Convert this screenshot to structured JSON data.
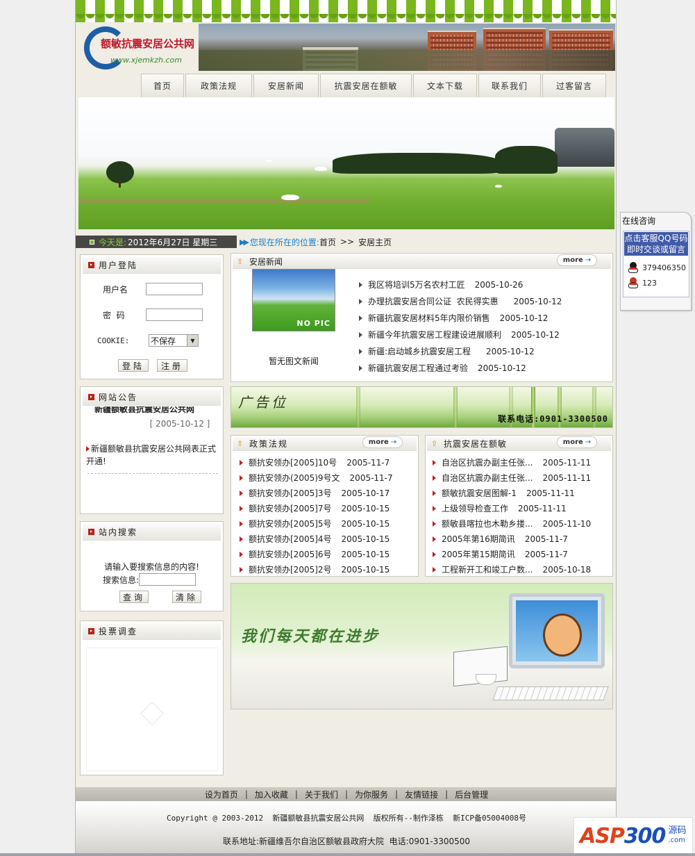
{
  "site": {
    "logo_title": "额敏抗震安居公共网",
    "logo_url": "www.xjemkzh.com"
  },
  "nav": [
    "首页",
    "政策法规",
    "安居新闻",
    "抗震安居在额敏",
    "文本下载",
    "联系我们",
    "过客留言"
  ],
  "status": {
    "date_label": "今天是:",
    "date_value": "2012年6月27日 星期三",
    "location_label": "您现在所在的位置:",
    "location_home": "首页",
    "location_sep": ">>",
    "location_current": "安居主页"
  },
  "login": {
    "title": "用户登陆",
    "username_label": "用户名",
    "password_label": "密  码",
    "cookie_label": "COOKIE:",
    "cookie_value": "不保存",
    "login_btn": "登陆",
    "register_btn": "注册"
  },
  "notice": {
    "title": "网站公告",
    "scroll_text": "新疆额敏县抗震安居公共网",
    "date": "[ 2005-10-12 ]",
    "item": "新疆额敏县抗震安居公共网表正式开通!"
  },
  "search": {
    "title": "站内搜索",
    "prompt": "请输入要搜索信息的内容!",
    "label": "搜索信息:",
    "query_btn": "查询",
    "clear_btn": "清除"
  },
  "poll": {
    "title": "投票调查"
  },
  "news": {
    "title": "安居新闻",
    "more": "more",
    "no_pic": "NO PIC",
    "no_pic_caption": "暂无图文新闻",
    "items": [
      {
        "title": "我区将培训5万名农村工匠",
        "date": "2005-10-26"
      },
      {
        "title": "办理抗震安居合同公证  农民得实惠",
        "date": "2005-10-12"
      },
      {
        "title": "新疆抗震安居材料5年内限价销售",
        "date": "2005-10-12"
      },
      {
        "title": "新疆今年抗震安居工程建设进展顺利",
        "date": "2005-10-12"
      },
      {
        "title": "新疆:启动城乡抗震安居工程",
        "date": "2005-10-12"
      },
      {
        "title": "新疆抗震安居工程通过考验",
        "date": "2005-10-12"
      }
    ]
  },
  "ad": {
    "title": "广告位",
    "phone": "联系电话:0901-3300500",
    "slogan": "我们每天都在进步"
  },
  "policy": {
    "title": "政策法规",
    "more": "more",
    "items": [
      {
        "title": "额抗安领办[2005]10号",
        "date": "2005-11-7"
      },
      {
        "title": "额抗安领办(2005)9号文",
        "date": "2005-11-7"
      },
      {
        "title": "额抗安领办[2005]3号",
        "date": "2005-10-17"
      },
      {
        "title": "额抗安领办[2005]7号",
        "date": "2005-10-15"
      },
      {
        "title": "额抗安领办[2005]5号",
        "date": "2005-10-15"
      },
      {
        "title": "额抗安领办[2005]4号",
        "date": "2005-10-15"
      },
      {
        "title": "额抗安领办[2005]6号",
        "date": "2005-10-15"
      },
      {
        "title": "额抗安领办[2005]2号",
        "date": "2005-10-15"
      }
    ]
  },
  "emin": {
    "title": "抗震安居在额敏",
    "more": "more",
    "items": [
      {
        "title": "自治区抗震办副主任张...",
        "date": "2005-11-11"
      },
      {
        "title": "自治区抗震办副主任张...",
        "date": "2005-11-11"
      },
      {
        "title": "额敏抗震安居图解-1",
        "date": "2005-11-11"
      },
      {
        "title": "上级领导检查工作",
        "date": "2005-11-11"
      },
      {
        "title": "额敏县喀拉也木勒乡搂...",
        "date": "2005-11-10"
      },
      {
        "title": "2005年第16期简讯",
        "date": "2005-11-7"
      },
      {
        "title": "2005年第15期简讯",
        "date": "2005-11-7"
      },
      {
        "title": "工程新开工和竣工户数...",
        "date": "2005-10-18"
      }
    ]
  },
  "footer": {
    "links": [
      "设为首页",
      "加入收藏",
      "关于我们",
      "为你服务",
      "友情链接",
      "后台管理"
    ],
    "copyright": "Copyright @ 2003-2012  新疆额敏县抗震安居公共网  版权所有--制作泽栋  新ICP备05004008号",
    "address": "联系地址:新疆维吾尔自治区额敏县政府大院  电话:0901-3300500"
  },
  "consult": {
    "title": "在线咨询",
    "note": "点击客服QQ号码即时交谈或留言",
    "qq": [
      "379406350",
      "123"
    ]
  },
  "corner_logo": {
    "asp": "ASP",
    "num": "300",
    "zh": "源码",
    "com": ".com"
  }
}
